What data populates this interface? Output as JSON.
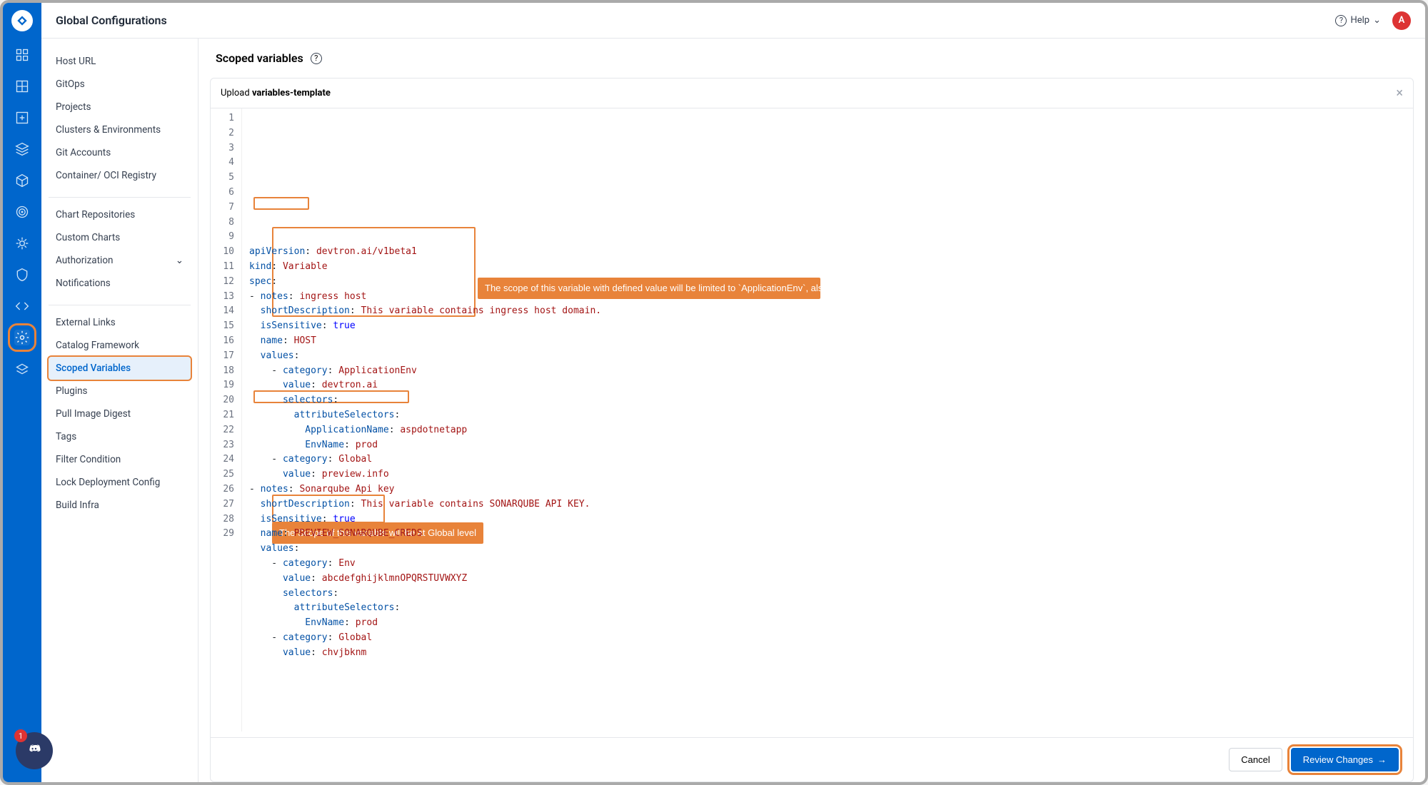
{
  "topbar": {
    "title": "Global Configurations",
    "help_label": "Help",
    "avatar_initial": "A"
  },
  "rail": {
    "discord_badge": "1"
  },
  "sidebar": {
    "group1": [
      "Host URL",
      "GitOps",
      "Projects",
      "Clusters & Environments",
      "Git Accounts",
      "Container/ OCI Registry"
    ],
    "group2": [
      "Chart Repositories",
      "Custom Charts",
      "Authorization",
      "Notifications"
    ],
    "group3": [
      "External Links",
      "Catalog Framework",
      "Scoped Variables",
      "Plugins",
      "Pull Image Digest",
      "Tags",
      "Filter Condition",
      "Lock Deployment Config",
      "Build Infra"
    ],
    "active": "Scoped Variables"
  },
  "content": {
    "heading": "Scoped variables",
    "upload_prefix": "Upload ",
    "upload_filename": "variables-template",
    "cancel_label": "Cancel",
    "review_label": "Review Changes"
  },
  "callouts": {
    "c1": "The scope of this variable with defined value will be limited to `ApplicationEnv`, also in that specific for `aspdotnetapp` with EnvName as `prod`",
    "c2": "The Scope of this variable will be at Global level"
  },
  "code": {
    "lines": [
      [
        [
          "key",
          "apiVersion"
        ],
        [
          "punc",
          ": "
        ],
        [
          "str",
          "devtron.ai/v1beta1"
        ]
      ],
      [
        [
          "key",
          "kind"
        ],
        [
          "punc",
          ": "
        ],
        [
          "str",
          "Variable"
        ]
      ],
      [
        [
          "key",
          "spec"
        ],
        [
          "punc",
          ":"
        ]
      ],
      [
        [
          "punc",
          "- "
        ],
        [
          "key",
          "notes"
        ],
        [
          "punc",
          ": "
        ],
        [
          "str",
          "ingress host"
        ]
      ],
      [
        [
          "punc",
          "  "
        ],
        [
          "key",
          "shortDescription"
        ],
        [
          "punc",
          ": "
        ],
        [
          "str",
          "This variable contains ingress host domain."
        ]
      ],
      [
        [
          "punc",
          "  "
        ],
        [
          "key",
          "isSensitive"
        ],
        [
          "punc",
          ": "
        ],
        [
          "bool",
          "true"
        ]
      ],
      [
        [
          "punc",
          "  "
        ],
        [
          "key",
          "name"
        ],
        [
          "punc",
          ": "
        ],
        [
          "str",
          "HOST"
        ]
      ],
      [
        [
          "punc",
          "  "
        ],
        [
          "key",
          "values"
        ],
        [
          "punc",
          ":"
        ]
      ],
      [
        [
          "punc",
          "    - "
        ],
        [
          "key",
          "category"
        ],
        [
          "punc",
          ": "
        ],
        [
          "str",
          "ApplicationEnv"
        ]
      ],
      [
        [
          "punc",
          "      "
        ],
        [
          "key",
          "value"
        ],
        [
          "punc",
          ": "
        ],
        [
          "str",
          "devtron.ai"
        ]
      ],
      [
        [
          "punc",
          "      "
        ],
        [
          "key",
          "selectors"
        ],
        [
          "punc",
          ":"
        ]
      ],
      [
        [
          "punc",
          "        "
        ],
        [
          "key",
          "attributeSelectors"
        ],
        [
          "punc",
          ":"
        ]
      ],
      [
        [
          "punc",
          "          "
        ],
        [
          "key",
          "ApplicationName"
        ],
        [
          "punc",
          ": "
        ],
        [
          "str",
          "aspdotnetapp"
        ]
      ],
      [
        [
          "punc",
          "          "
        ],
        [
          "key",
          "EnvName"
        ],
        [
          "punc",
          ": "
        ],
        [
          "str",
          "prod"
        ]
      ],
      [
        [
          "punc",
          "    - "
        ],
        [
          "key",
          "category"
        ],
        [
          "punc",
          ": "
        ],
        [
          "str",
          "Global"
        ]
      ],
      [
        [
          "punc",
          "      "
        ],
        [
          "key",
          "value"
        ],
        [
          "punc",
          ": "
        ],
        [
          "str",
          "preview.info"
        ]
      ],
      [
        [
          "punc",
          "- "
        ],
        [
          "key",
          "notes"
        ],
        [
          "punc",
          ": "
        ],
        [
          "str",
          "Sonarqube Api key"
        ]
      ],
      [
        [
          "punc",
          "  "
        ],
        [
          "key",
          "shortDescription"
        ],
        [
          "punc",
          ": "
        ],
        [
          "str",
          "This variable contains SONARQUBE API KEY."
        ]
      ],
      [
        [
          "punc",
          "  "
        ],
        [
          "key",
          "isSensitive"
        ],
        [
          "punc",
          ": "
        ],
        [
          "bool",
          "true"
        ]
      ],
      [
        [
          "punc",
          "  "
        ],
        [
          "key",
          "name"
        ],
        [
          "punc",
          ": "
        ],
        [
          "str",
          "PREVIEW_SONARQUBE_CREDS"
        ]
      ],
      [
        [
          "punc",
          "  "
        ],
        [
          "key",
          "values"
        ],
        [
          "punc",
          ":"
        ]
      ],
      [
        [
          "punc",
          "    - "
        ],
        [
          "key",
          "category"
        ],
        [
          "punc",
          ": "
        ],
        [
          "str",
          "Env"
        ]
      ],
      [
        [
          "punc",
          "      "
        ],
        [
          "key",
          "value"
        ],
        [
          "punc",
          ": "
        ],
        [
          "str",
          "abcdefghijklmnOPQRSTUVWXYZ"
        ]
      ],
      [
        [
          "punc",
          "      "
        ],
        [
          "key",
          "selectors"
        ],
        [
          "punc",
          ":"
        ]
      ],
      [
        [
          "punc",
          "        "
        ],
        [
          "key",
          "attributeSelectors"
        ],
        [
          "punc",
          ":"
        ]
      ],
      [
        [
          "punc",
          "          "
        ],
        [
          "key",
          "EnvName"
        ],
        [
          "punc",
          ": "
        ],
        [
          "str",
          "prod"
        ]
      ],
      [
        [
          "punc",
          "    - "
        ],
        [
          "key",
          "category"
        ],
        [
          "punc",
          ": "
        ],
        [
          "str",
          "Global"
        ]
      ],
      [
        [
          "punc",
          "      "
        ],
        [
          "key",
          "value"
        ],
        [
          "punc",
          ": "
        ],
        [
          "str",
          "chvjbknm"
        ]
      ],
      [
        [
          "punc",
          ""
        ]
      ]
    ]
  }
}
